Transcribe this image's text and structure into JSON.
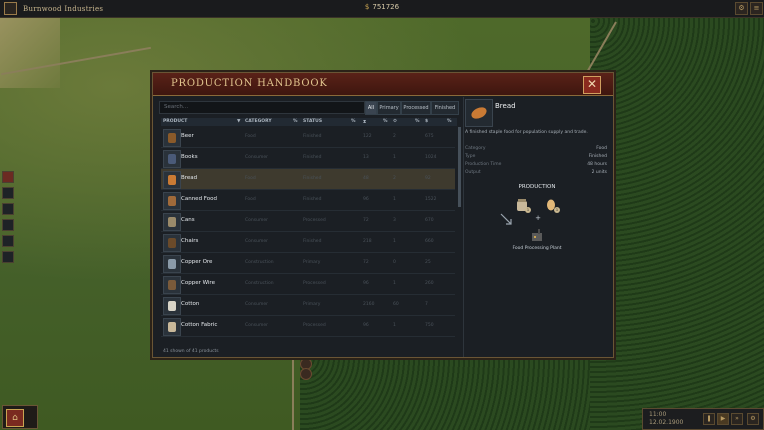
{
  "topbar": {
    "company": "Burnwood Industries",
    "money": "751726",
    "icons": [
      "gear-icon",
      "menu-icon"
    ]
  },
  "handbook": {
    "title": "PRODUCTION HANDBOOK",
    "search_placeholder": "Search...",
    "filters": [
      "All",
      "Primary",
      "Processed",
      "Finished"
    ],
    "active_filter": "All",
    "columns": [
      "PRODUCT",
      "CATEGORY",
      "STATUS"
    ],
    "products": [
      {
        "name": "Beer",
        "category": "Food",
        "status": "Finished",
        "a": "122",
        "b": "2",
        "c": "675",
        "color": "#8a5a2a"
      },
      {
        "name": "Books",
        "category": "Consumer",
        "status": "Finished",
        "a": "13",
        "b": "1",
        "c": "1024",
        "color": "#4a5a78"
      },
      {
        "name": "Bread",
        "category": "Food",
        "status": "Finished",
        "a": "48",
        "b": "2",
        "c": "92",
        "color": "#c97a34"
      },
      {
        "name": "Canned Food",
        "category": "Food",
        "status": "Finished",
        "a": "96",
        "b": "1",
        "c": "1522",
        "color": "#a06a3a"
      },
      {
        "name": "Cans",
        "category": "Consumer",
        "status": "Processed",
        "a": "72",
        "b": "3",
        "c": "670",
        "color": "#9a8a6a"
      },
      {
        "name": "Chairs",
        "category": "Consumer",
        "status": "Finished",
        "a": "218",
        "b": "1",
        "c": "660",
        "color": "#6a4a2a"
      },
      {
        "name": "Copper Ore",
        "category": "Construction",
        "status": "Primary",
        "a": "72",
        "b": "0",
        "c": "25",
        "color": "#8a9aa8"
      },
      {
        "name": "Copper Wire",
        "category": "Construction",
        "status": "Processed",
        "a": "96",
        "b": "1",
        "c": "260",
        "color": "#7a5a3a"
      },
      {
        "name": "Cotton",
        "category": "Consumer",
        "status": "Primary",
        "a": "2160",
        "b": "60",
        "c": "7",
        "color": "#d8d4c8"
      },
      {
        "name": "Cotton Fabric",
        "category": "Consumer",
        "status": "Processed",
        "a": "96",
        "b": "1",
        "c": "750",
        "color": "#c8b89a"
      }
    ],
    "selected_product": "Bread",
    "count_text": "41 shown of 41 products"
  },
  "detail": {
    "name": "Bread",
    "description": "A finished staple food for population supply and trade.",
    "attributes": [
      {
        "key": "Category",
        "value": "Food"
      },
      {
        "key": "Type",
        "value": "Finished"
      },
      {
        "key": "Production Time",
        "value": "48 hours"
      },
      {
        "key": "Output",
        "value": "2 units"
      }
    ],
    "production_title": "PRODUCTION",
    "input_badges": [
      "1",
      "1"
    ],
    "plant": "Food Processing Plant"
  },
  "clock": {
    "time": "11:00",
    "date": "12.02.1900"
  }
}
